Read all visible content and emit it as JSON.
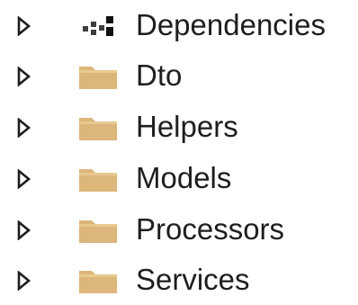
{
  "solution_explorer": {
    "items": [
      {
        "label": "Dependencies",
        "icon": "dependencies-icon"
      },
      {
        "label": "Dto",
        "icon": "folder-icon"
      },
      {
        "label": "Helpers",
        "icon": "folder-icon"
      },
      {
        "label": "Models",
        "icon": "folder-icon"
      },
      {
        "label": "Processors",
        "icon": "folder-icon"
      },
      {
        "label": "Services",
        "icon": "folder-icon"
      }
    ]
  },
  "colors": {
    "folder": "#dcb67a",
    "folder_tab": "#d4a95f",
    "expander_stroke": "#1e1e1e",
    "text": "#1e1e1e",
    "background": "#ffffff"
  }
}
